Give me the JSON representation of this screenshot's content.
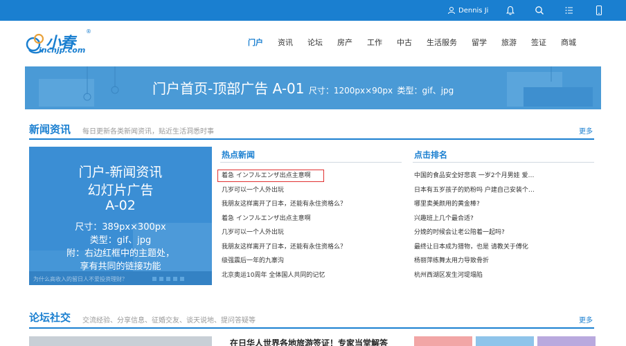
{
  "topbar": {
    "user_name": "Dennis Ji",
    "icons": [
      "user-icon",
      "bell-icon",
      "search-icon",
      "menu-list-icon",
      "mobile-icon"
    ]
  },
  "logo": {
    "name": "小春",
    "registered": "®",
    "domain": "incnjp.com"
  },
  "nav": {
    "items": [
      "门户",
      "资讯",
      "论坛",
      "房产",
      "工作",
      "中古",
      "生活服务",
      "留学",
      "旅游",
      "签证",
      "商城"
    ],
    "active_index": 0
  },
  "banner": {
    "title": "门户首页-顶部广告 A-01",
    "size": "尺寸：1200px×90px",
    "type": "类型：gif、jpg"
  },
  "news": {
    "title": "新闻资讯",
    "subtitle": "每日更新各类新闻资讯，贴近生活洞悉时事",
    "more": "更多",
    "slide": {
      "line1": "门户-新闻资讯",
      "line2": "幻灯片广告",
      "line3": "A-02",
      "line4": "尺寸：389px×300px",
      "line5": "类型：gif、jpg",
      "line6": "附：右边红框中的主题处，",
      "line7": "享有共同的链接功能",
      "caption": "为什么高收入的留日人不爱投资理财？"
    },
    "hot": {
      "title": "热点新闻",
      "items": [
        "着急 インフルエンザ出点主意啊",
        "几岁可以一个人外出玩",
        "我朋友这样离开了日本，还能有永住资格么？",
        "着急 インフルエンザ出点主意啊",
        "几岁可以一个人外出玩",
        "我朋友这样离开了日本，还能有永住资格么？",
        "级强震后一年的九寨沟",
        "北京奥运10周年 全体国人共同的记忆"
      ]
    },
    "rank": {
      "title": "点击排名",
      "items": [
        "中国的食品安全好悲哀 一岁2个月男娃 爱…",
        "日本有五岁孩子的奶粉吗 户建自己安装个…",
        "哪里卖美颜用的黄金棒?",
        "兴趣班上几个最合适?",
        "分娩的时候会让老公陪着一起吗?",
        "最终让日本成为猎物，也是 请教关于傅化",
        "杨丽萍练舞太用力导致骨折",
        "杭州西湖区发生河堤塌陷"
      ]
    }
  },
  "forum": {
    "title": "论坛社交",
    "subtitle": "交流经验、分享信息、征婚交友、谈天说地、提问答疑等",
    "more": "更多",
    "headline": "在日华人世界各地旅游签证！专家当堂解答"
  },
  "colors": {
    "brand_blue": "#1a7fd0",
    "highlight_red": "#e03030"
  }
}
